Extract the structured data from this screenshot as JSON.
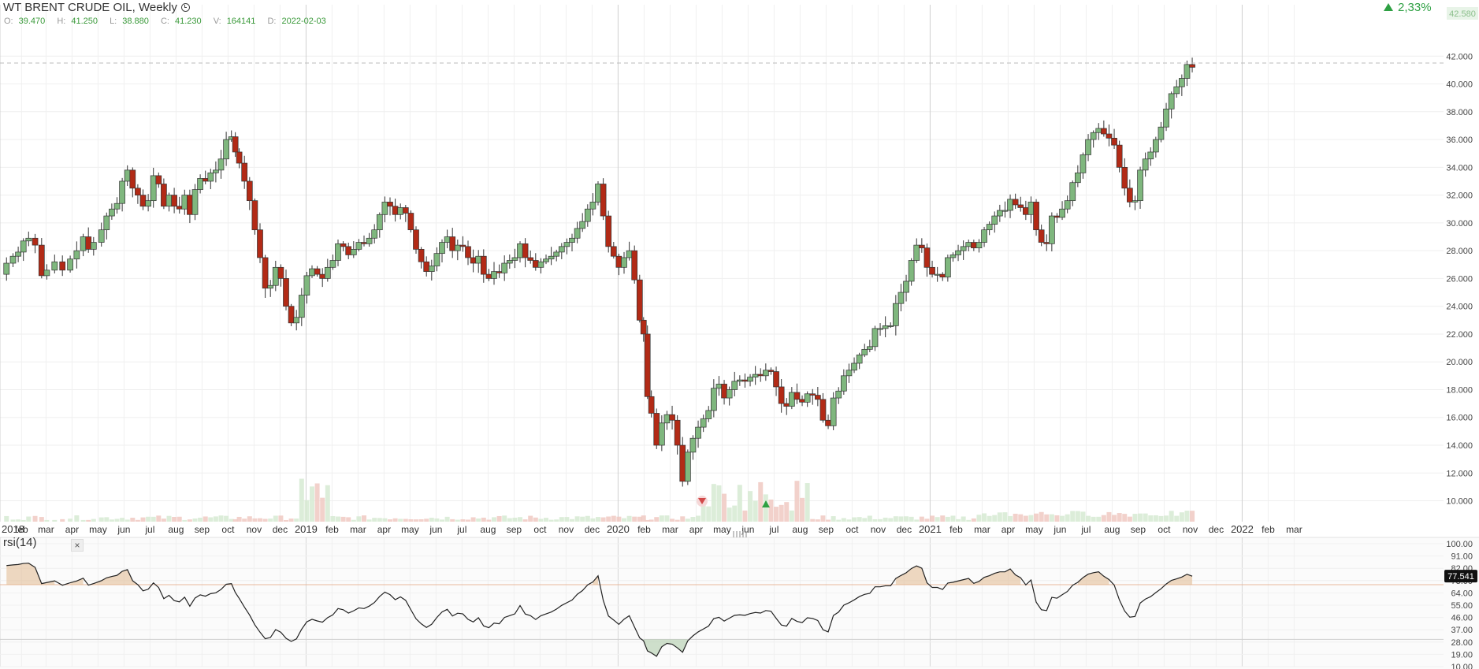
{
  "header": {
    "title": "WT BRENT CRUDE OIL, Weekly",
    "ohlc": [
      {
        "key": "O:",
        "value": "39.470"
      },
      {
        "key": "H:",
        "value": "41.250"
      },
      {
        "key": "L:",
        "value": "38.880"
      },
      {
        "key": "C:",
        "value": "41.230"
      },
      {
        "key": "V:",
        "value": "164141"
      },
      {
        "key": "D:",
        "value": "2022-02-03"
      }
    ],
    "change": "2,33%",
    "last_price": "42.580"
  },
  "rsi_panel": {
    "label": "rsi(14)",
    "close": "×",
    "last_value": "77.541"
  },
  "colors": {
    "up": "#7fb77e",
    "down": "#b22a16",
    "rsi_line": "#222222",
    "accent_green": "#2ea043"
  },
  "chart_data": {
    "type": "candlestick",
    "price_axis": {
      "min": 8.5,
      "max": 44,
      "ticks": [
        "10.000",
        "12.000",
        "14.000",
        "16.000",
        "18.000",
        "20.000",
        "22.000",
        "24.000",
        "26.000",
        "28.000",
        "30.000",
        "32.000",
        "34.000",
        "36.000",
        "38.000",
        "40.000",
        "42.000"
      ]
    },
    "rsi_axis": {
      "min": 10,
      "max": 100,
      "ticks": [
        "10.00",
        "19.00",
        "28.00",
        "37.00",
        "46.00",
        "55.00",
        "64.00",
        "73.00",
        "82.00",
        "91.00",
        "100.00"
      ],
      "overbought": 70,
      "oversold": 30
    },
    "x_labels": [
      {
        "t": "2018",
        "pos": 0,
        "year": true
      },
      {
        "t": "feb",
        "pos": 0.83
      },
      {
        "t": "mar",
        "pos": 1.77
      },
      {
        "t": "apr",
        "pos": 2.77
      },
      {
        "t": "may",
        "pos": 3.77
      },
      {
        "t": "jun",
        "pos": 4.77
      },
      {
        "t": "jul",
        "pos": 5.77
      },
      {
        "t": "aug",
        "pos": 6.77
      },
      {
        "t": "sep",
        "pos": 7.77
      },
      {
        "t": "oct",
        "pos": 8.77
      },
      {
        "t": "nov",
        "pos": 9.77
      },
      {
        "t": "dec",
        "pos": 10.77
      },
      {
        "t": "2019",
        "pos": 11.77,
        "year": true
      },
      {
        "t": "feb",
        "pos": 12.77
      },
      {
        "t": "mar",
        "pos": 13.77
      },
      {
        "t": "apr",
        "pos": 14.77
      },
      {
        "t": "may",
        "pos": 15.77
      },
      {
        "t": "jun",
        "pos": 16.77
      },
      {
        "t": "jul",
        "pos": 17.77
      },
      {
        "t": "aug",
        "pos": 18.77
      },
      {
        "t": "sep",
        "pos": 19.77
      },
      {
        "t": "oct",
        "pos": 20.77
      },
      {
        "t": "nov",
        "pos": 21.77
      },
      {
        "t": "dec",
        "pos": 22.77
      },
      {
        "t": "2020",
        "pos": 23.77,
        "year": true
      },
      {
        "t": "feb",
        "pos": 24.77
      },
      {
        "t": "mar",
        "pos": 25.77
      },
      {
        "t": "apr",
        "pos": 26.77
      },
      {
        "t": "may",
        "pos": 27.77
      },
      {
        "t": "jun",
        "pos": 28.77
      },
      {
        "t": "jul",
        "pos": 29.77
      },
      {
        "t": "aug",
        "pos": 30.77
      },
      {
        "t": "sep",
        "pos": 31.77
      },
      {
        "t": "oct",
        "pos": 32.77
      },
      {
        "t": "nov",
        "pos": 33.77
      },
      {
        "t": "dec",
        "pos": 34.77
      },
      {
        "t": "2021",
        "pos": 35.77,
        "year": true
      },
      {
        "t": "feb",
        "pos": 36.77
      },
      {
        "t": "mar",
        "pos": 37.77
      },
      {
        "t": "apr",
        "pos": 38.77
      },
      {
        "t": "may",
        "pos": 39.77
      },
      {
        "t": "jun",
        "pos": 40.77
      },
      {
        "t": "jul",
        "pos": 41.77
      },
      {
        "t": "aug",
        "pos": 42.77
      },
      {
        "t": "sep",
        "pos": 43.77
      },
      {
        "t": "oct",
        "pos": 44.77
      },
      {
        "t": "nov",
        "pos": 45.77
      },
      {
        "t": "dec",
        "pos": 46.77
      },
      {
        "t": "2022",
        "pos": 47.77,
        "year": true
      },
      {
        "t": "feb",
        "pos": 48.77
      },
      {
        "t": "mar",
        "pos": 49.77
      }
    ],
    "close_points": [
      [
        0,
        26.3
      ],
      [
        0.25,
        27.1
      ],
      [
        0.5,
        27.6
      ],
      [
        0.7,
        27.9
      ],
      [
        0.9,
        28.7
      ],
      [
        1.1,
        28.9
      ],
      [
        1.35,
        28.4
      ],
      [
        1.6,
        26.2
      ],
      [
        1.8,
        26.6
      ],
      [
        2.1,
        27.2
      ],
      [
        2.4,
        26.6
      ],
      [
        2.7,
        27.4
      ],
      [
        2.95,
        28.0
      ],
      [
        3.2,
        29.0
      ],
      [
        3.4,
        28.1
      ],
      [
        3.6,
        28.6
      ],
      [
        3.9,
        29.5
      ],
      [
        4.1,
        30.5
      ],
      [
        4.3,
        31.0
      ],
      [
        4.5,
        31.4
      ],
      [
        4.7,
        33.0
      ],
      [
        4.9,
        33.8
      ],
      [
        5.1,
        32.5
      ],
      [
        5.3,
        32.0
      ],
      [
        5.5,
        31.2
      ],
      [
        5.7,
        31.6
      ],
      [
        5.9,
        33.4
      ],
      [
        6.1,
        32.8
      ],
      [
        6.3,
        31.2
      ],
      [
        6.5,
        32.0
      ],
      [
        6.7,
        31.2
      ],
      [
        6.9,
        31.0
      ],
      [
        7.1,
        32.0
      ],
      [
        7.3,
        30.6
      ],
      [
        7.5,
        32.4
      ],
      [
        7.7,
        33.2
      ],
      [
        7.9,
        33.0
      ],
      [
        8.1,
        33.6
      ],
      [
        8.3,
        33.8
      ],
      [
        8.5,
        34.6
      ],
      [
        8.7,
        36.0
      ],
      [
        8.9,
        36.2
      ],
      [
        9.05,
        35.1
      ],
      [
        9.2,
        34.3
      ],
      [
        9.4,
        33.0
      ],
      [
        9.6,
        31.6
      ],
      [
        9.8,
        29.5
      ],
      [
        10.0,
        27.5
      ],
      [
        10.2,
        25.3
      ],
      [
        10.4,
        25.5
      ],
      [
        10.6,
        26.8
      ],
      [
        10.8,
        26.0
      ],
      [
        11.0,
        24.0
      ],
      [
        11.2,
        22.8
      ],
      [
        11.4,
        23.2
      ],
      [
        11.6,
        24.8
      ],
      [
        11.8,
        26.2
      ],
      [
        12.0,
        26.7
      ],
      [
        12.2,
        26.3
      ],
      [
        12.4,
        26.0
      ],
      [
        12.6,
        26.8
      ],
      [
        12.8,
        27.3
      ],
      [
        13.0,
        28.5
      ],
      [
        13.2,
        28.3
      ],
      [
        13.4,
        27.7
      ],
      [
        13.6,
        28.1
      ],
      [
        13.8,
        28.6
      ],
      [
        14.0,
        28.5
      ],
      [
        14.2,
        28.9
      ],
      [
        14.4,
        29.5
      ],
      [
        14.6,
        30.6
      ],
      [
        14.8,
        31.5
      ],
      [
        15.0,
        31.2
      ],
      [
        15.2,
        30.6
      ],
      [
        15.4,
        31.1
      ],
      [
        15.6,
        30.7
      ],
      [
        15.8,
        29.5
      ],
      [
        16.0,
        28.1
      ],
      [
        16.2,
        27.2
      ],
      [
        16.4,
        26.5
      ],
      [
        16.6,
        26.9
      ],
      [
        16.8,
        27.8
      ],
      [
        17.0,
        28.6
      ],
      [
        17.2,
        29.0
      ],
      [
        17.4,
        28.0
      ],
      [
        17.6,
        28.4
      ],
      [
        17.8,
        28.3
      ],
      [
        18.0,
        27.5
      ],
      [
        18.2,
        27.1
      ],
      [
        18.4,
        27.6
      ],
      [
        18.6,
        26.3
      ],
      [
        18.8,
        26.0
      ],
      [
        19.0,
        26.5
      ],
      [
        19.2,
        26.4
      ],
      [
        19.4,
        27.1
      ],
      [
        19.6,
        27.3
      ],
      [
        19.8,
        27.5
      ],
      [
        20.0,
        28.5
      ],
      [
        20.2,
        27.5
      ],
      [
        20.4,
        27.3
      ],
      [
        20.6,
        26.8
      ],
      [
        20.8,
        27.2
      ],
      [
        21.0,
        27.4
      ],
      [
        21.2,
        27.6
      ],
      [
        21.4,
        27.9
      ],
      [
        21.6,
        28.3
      ],
      [
        21.8,
        28.6
      ],
      [
        22.0,
        28.9
      ],
      [
        22.2,
        29.6
      ],
      [
        22.4,
        30.1
      ],
      [
        22.6,
        31.0
      ],
      [
        22.8,
        31.5
      ],
      [
        23.0,
        32.8
      ],
      [
        23.2,
        30.5
      ],
      [
        23.4,
        28.3
      ],
      [
        23.6,
        27.6
      ],
      [
        23.8,
        26.8
      ],
      [
        24.0,
        27.5
      ],
      [
        24.2,
        28.0
      ],
      [
        24.4,
        25.9
      ],
      [
        24.6,
        23.0
      ],
      [
        24.75,
        22.0
      ],
      [
        24.9,
        17.5
      ],
      [
        25.05,
        16.3
      ],
      [
        25.25,
        14.0
      ],
      [
        25.45,
        15.6
      ],
      [
        25.65,
        16.2
      ],
      [
        25.85,
        15.8
      ],
      [
        26.05,
        14.0
      ],
      [
        26.25,
        11.4
      ],
      [
        26.45,
        13.5
      ],
      [
        26.65,
        14.5
      ],
      [
        26.85,
        15.3
      ],
      [
        27.05,
        15.9
      ],
      [
        27.25,
        16.5
      ],
      [
        27.45,
        18.1
      ],
      [
        27.65,
        18.4
      ],
      [
        27.85,
        17.4
      ],
      [
        28.05,
        18.0
      ],
      [
        28.25,
        18.6
      ],
      [
        28.45,
        18.7
      ],
      [
        28.65,
        18.6
      ],
      [
        28.85,
        18.9
      ],
      [
        29.05,
        19.1
      ],
      [
        29.25,
        19.0
      ],
      [
        29.45,
        19.4
      ],
      [
        29.65,
        19.3
      ],
      [
        29.85,
        18.2
      ],
      [
        30.05,
        17.0
      ],
      [
        30.25,
        16.8
      ],
      [
        30.45,
        17.8
      ],
      [
        30.65,
        17.3
      ],
      [
        30.85,
        17.1
      ],
      [
        31.05,
        17.7
      ],
      [
        31.25,
        17.6
      ],
      [
        31.45,
        17.3
      ],
      [
        31.65,
        15.8
      ],
      [
        31.85,
        15.4
      ],
      [
        32.05,
        17.4
      ],
      [
        32.25,
        17.9
      ],
      [
        32.45,
        19.0
      ],
      [
        32.65,
        19.4
      ],
      [
        32.85,
        19.9
      ],
      [
        33.05,
        20.5
      ],
      [
        33.25,
        20.9
      ],
      [
        33.45,
        21.1
      ],
      [
        33.65,
        22.4
      ],
      [
        33.85,
        22.4
      ],
      [
        34.05,
        22.6
      ],
      [
        34.25,
        22.6
      ],
      [
        34.45,
        24.2
      ],
      [
        34.65,
        25.0
      ],
      [
        34.85,
        25.8
      ],
      [
        35.05,
        27.3
      ],
      [
        35.25,
        28.4
      ],
      [
        35.45,
        28.2
      ],
      [
        35.65,
        26.8
      ],
      [
        35.85,
        26.3
      ],
      [
        36.05,
        26.3
      ],
      [
        36.25,
        26.1
      ],
      [
        36.45,
        27.5
      ],
      [
        36.65,
        27.7
      ],
      [
        36.85,
        28.0
      ],
      [
        37.05,
        28.3
      ],
      [
        37.25,
        28.6
      ],
      [
        37.45,
        28.2
      ],
      [
        37.65,
        28.6
      ],
      [
        37.85,
        29.5
      ],
      [
        38.05,
        29.9
      ],
      [
        38.25,
        30.5
      ],
      [
        38.45,
        30.9
      ],
      [
        38.65,
        30.9
      ],
      [
        38.85,
        31.7
      ],
      [
        39.05,
        31.3
      ],
      [
        39.25,
        31.1
      ],
      [
        39.45,
        30.6
      ],
      [
        39.65,
        31.5
      ],
      [
        39.85,
        29.5
      ],
      [
        40.05,
        28.6
      ],
      [
        40.25,
        28.5
      ],
      [
        40.45,
        30.5
      ],
      [
        40.65,
        30.4
      ],
      [
        40.85,
        31.0
      ],
      [
        41.05,
        31.6
      ],
      [
        41.25,
        32.9
      ],
      [
        41.45,
        33.6
      ],
      [
        41.65,
        34.9
      ],
      [
        41.85,
        36.0
      ],
      [
        42.05,
        36.5
      ],
      [
        42.25,
        36.8
      ],
      [
        42.45,
        36.4
      ],
      [
        42.65,
        36.1
      ],
      [
        42.85,
        35.6
      ],
      [
        43.05,
        34.0
      ],
      [
        43.25,
        32.5
      ],
      [
        43.45,
        31.5
      ],
      [
        43.65,
        31.6
      ],
      [
        43.85,
        33.8
      ],
      [
        44.05,
        34.6
      ],
      [
        44.25,
        35.1
      ],
      [
        44.45,
        36.0
      ],
      [
        44.65,
        36.9
      ],
      [
        44.85,
        38.2
      ],
      [
        45.05,
        39.3
      ],
      [
        45.25,
        39.8
      ],
      [
        45.45,
        40.4
      ],
      [
        45.65,
        41.4
      ],
      [
        45.85,
        41.2
      ]
    ]
  }
}
